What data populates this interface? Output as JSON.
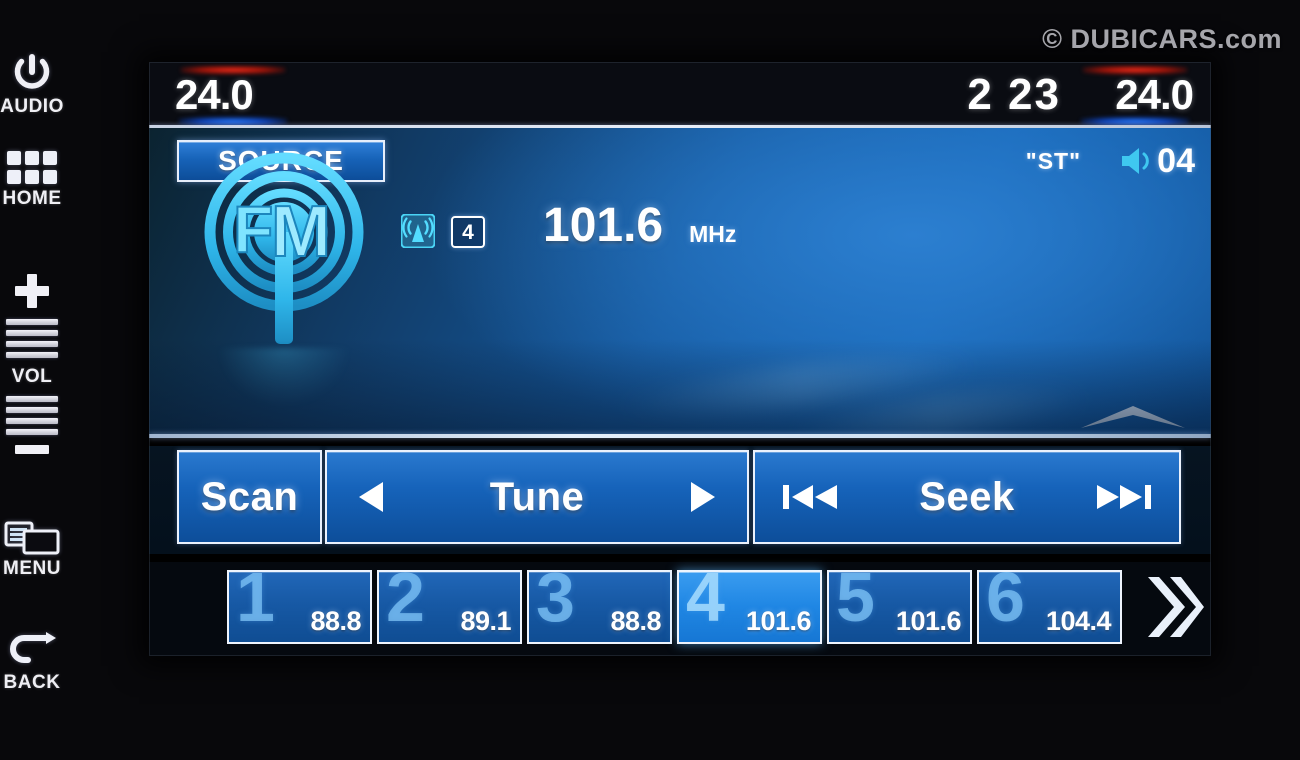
{
  "watermark": "© DUBICARS.com",
  "hardkeys": [
    {
      "id": "audio",
      "label": "AUDIO",
      "icon": "power-icon"
    },
    {
      "id": "home",
      "label": "HOME",
      "icon": "grid-icon"
    },
    {
      "id": "menu",
      "label": "MENU",
      "icon": "menu-icon"
    },
    {
      "id": "back",
      "label": "BACK",
      "icon": "back-arrow-icon"
    }
  ],
  "volume_rocker": {
    "plus": "+",
    "label": "VOL",
    "minus": "−"
  },
  "status_bar": {
    "temp_left": "24.0",
    "clock": "2 23",
    "temp_right": "24.0"
  },
  "display": {
    "source_label": "SOURCE",
    "stereo_indicator": "\"ST\"",
    "volume_level": "04",
    "band_logo": "FM",
    "broadcast_icon": "radio-tower-icon",
    "preset_badge": "4",
    "frequency": "101.6",
    "frequency_unit": "MHz",
    "expand_icon": "chevron-up-icon"
  },
  "controls": {
    "scan": "Scan",
    "tune": "Tune",
    "tune_prev_icon": "triangle-left-icon",
    "tune_next_icon": "triangle-right-icon",
    "seek": "Seek",
    "seek_prev_icon": "skip-back-icon",
    "seek_next_icon": "skip-forward-icon"
  },
  "presets": [
    {
      "number": "1",
      "freq": "88.8",
      "active": false
    },
    {
      "number": "2",
      "freq": "89.1",
      "active": false
    },
    {
      "number": "3",
      "freq": "88.8",
      "active": false
    },
    {
      "number": "4",
      "freq": "101.6",
      "active": true
    },
    {
      "number": "5",
      "freq": "101.6",
      "active": false
    },
    {
      "number": "6",
      "freq": "104.4",
      "active": false
    }
  ],
  "preset_next_icon": "double-chevron-right-icon",
  "colors": {
    "accent_blue": "#1763b8",
    "active_blue": "#2087e4",
    "cyan_logo": "#3fc8f0",
    "hot_red": "#ff3422",
    "cold_blue": "#2f86ff",
    "text_white": "#ffffff"
  }
}
